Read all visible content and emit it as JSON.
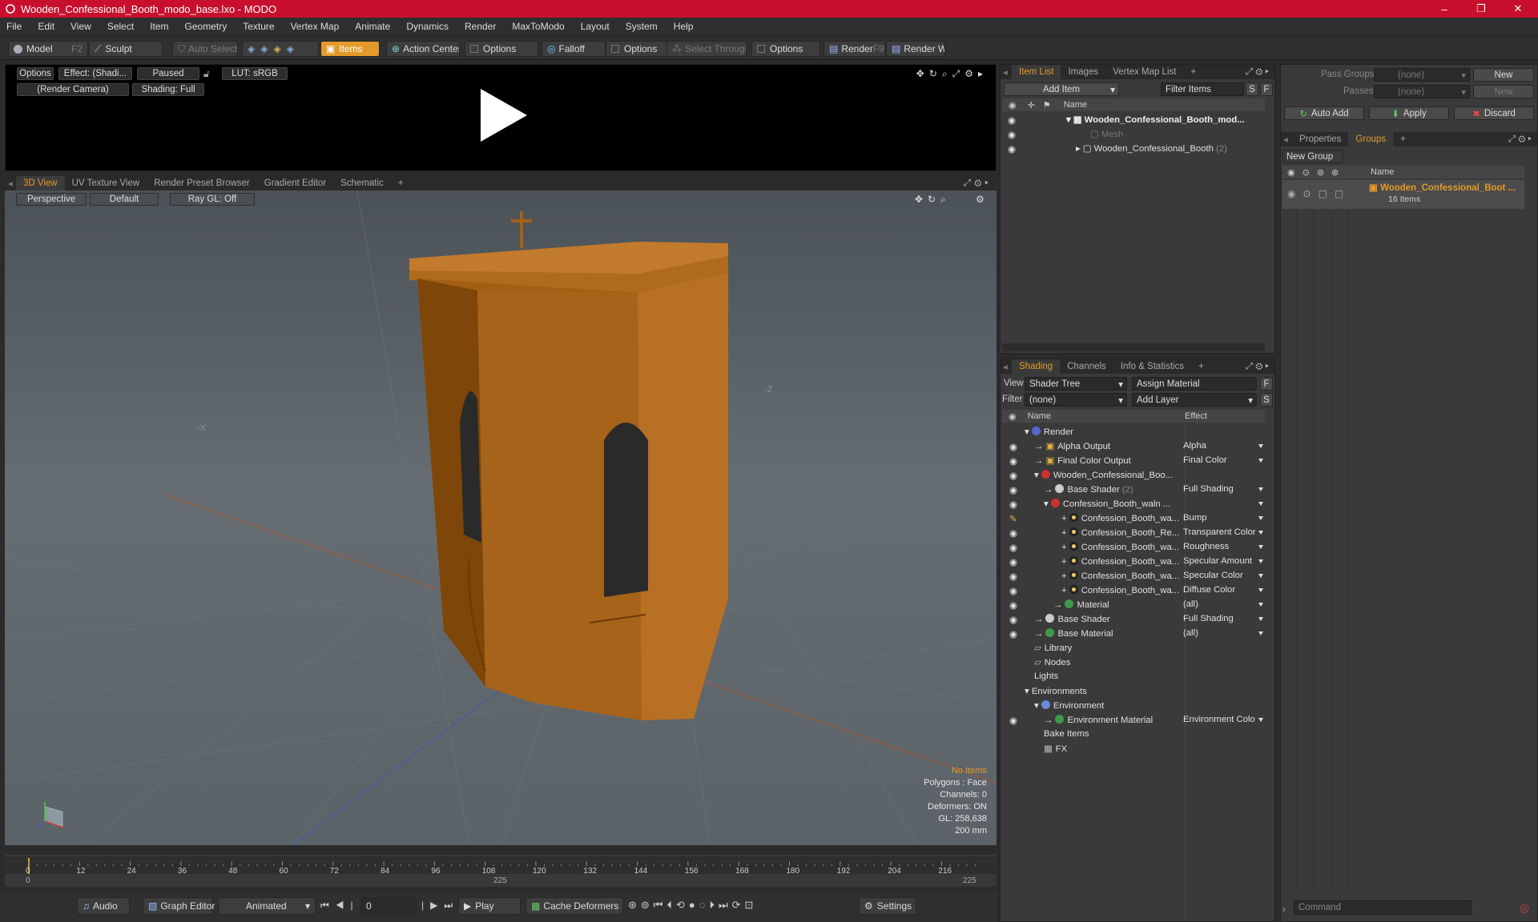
{
  "window": {
    "title": "Wooden_Confessional_Booth_modo_base.lxo - MODO",
    "minimize": "–",
    "maximize": "❐",
    "close": "✕"
  },
  "menu": [
    "File",
    "Edit",
    "View",
    "Select",
    "Item",
    "Geometry",
    "Texture",
    "Vertex Map",
    "Animate",
    "Dynamics",
    "Render",
    "MaxToModo",
    "Layout",
    "System",
    "Help"
  ],
  "toolbar": {
    "model": "Model",
    "model_key": "F2",
    "sculpt": "Sculpt",
    "auto_select": "Auto Select",
    "items": "Items",
    "action_center": "Action Center",
    "options1": "Options",
    "falloff": "Falloff",
    "options2": "Options",
    "select_through": "Select Through",
    "options3": "Options",
    "render": "Render",
    "render_key": "F9",
    "render_window": "Render Window"
  },
  "preview": {
    "options": "Options",
    "effect": "Effect: (Shadi...",
    "paused": "Paused",
    "lut": "LUT: sRGB",
    "camera": "(Render Camera)",
    "shading": "Shading: Full"
  },
  "view_tabs": [
    "3D View",
    "UV Texture View",
    "Render Preset Browser",
    "Gradient Editor",
    "Schematic",
    "+"
  ],
  "viewport": {
    "perspective": "Perspective",
    "default": "Default",
    "raygl": "Ray GL: Off",
    "axis_x": "-X",
    "axis_z": "-Z",
    "info": [
      "No Items",
      "Polygons : Face",
      "Channels: 0",
      "Deformers: ON",
      "GL: 258,638",
      "200 mm"
    ]
  },
  "timeline": {
    "ticks": [
      "0",
      "12",
      "24",
      "36",
      "48",
      "60",
      "72",
      "84",
      "96",
      "108",
      "120",
      "132",
      "144",
      "156",
      "168",
      "180",
      "192",
      "204",
      "216"
    ],
    "start": "0",
    "mid": "225",
    "end": "225"
  },
  "bottombar": {
    "audio": "Audio",
    "graph_editor": "Graph Editor",
    "animated": "Animated",
    "frame": "0",
    "play": "Play",
    "cache": "Cache Deformers",
    "settings": "Settings"
  },
  "item_list": {
    "tabs": [
      "Item List",
      "Images",
      "Vertex Map List",
      "+"
    ],
    "add_item": "Add Item",
    "filter": "Filter Items",
    "s": "S",
    "f": "F",
    "col_name": "Name",
    "rows": [
      {
        "name": "Wooden_Confessional_Booth_mod...",
        "count": ""
      },
      {
        "name": "Mesh",
        "count": ""
      },
      {
        "name": "Wooden_Confessional_Booth",
        "count": "(2)"
      }
    ]
  },
  "shading": {
    "tabs": [
      "Shading",
      "Channels",
      "Info & Statistics",
      "+"
    ],
    "view_label": "View",
    "view_value": "Shader Tree",
    "assign": "Assign Material",
    "f": "F",
    "filter_label": "Filter",
    "filter_value": "(none)",
    "add_layer": "Add Layer",
    "s": "S",
    "col_name": "Name",
    "col_effect": "Effect",
    "rows": [
      {
        "name": "Render",
        "effect": ""
      },
      {
        "name": "Alpha Output",
        "effect": "Alpha"
      },
      {
        "name": "Final Color Output",
        "effect": "Final Color"
      },
      {
        "name": "Wooden_Confessional_Boo...",
        "effect": ""
      },
      {
        "name": "Base Shader",
        "count": "(2)",
        "effect": "Full Shading"
      },
      {
        "name": "Confession_Booth_waln ...",
        "effect": ""
      },
      {
        "name": "Confession_Booth_wa...",
        "effect": "Bump"
      },
      {
        "name": "Confession_Booth_Re...",
        "effect": "Transparent Color"
      },
      {
        "name": "Confession_Booth_wa...",
        "effect": "Roughness"
      },
      {
        "name": "Confession_Booth_wa...",
        "effect": "Specular Amount"
      },
      {
        "name": "Confession_Booth_wa...",
        "effect": "Specular Color"
      },
      {
        "name": "Confession_Booth_wa...",
        "effect": "Diffuse Color"
      },
      {
        "name": "Material",
        "effect": "(all)"
      },
      {
        "name": "Base Shader",
        "effect": "Full Shading"
      },
      {
        "name": "Base Material",
        "effect": "(all)"
      },
      {
        "name": "Library",
        "effect": ""
      },
      {
        "name": "Nodes",
        "effect": ""
      },
      {
        "name": "Lights",
        "effect": ""
      },
      {
        "name": "Environments",
        "effect": ""
      },
      {
        "name": "Environment",
        "effect": ""
      },
      {
        "name": "Environment Material",
        "effect": "Environment Color"
      },
      {
        "name": "Bake Items",
        "effect": ""
      },
      {
        "name": "FX",
        "effect": ""
      }
    ]
  },
  "groups_panel": {
    "pass_groups": "Pass Groups",
    "pass_groups_value": "(none)",
    "new": "New",
    "passes": "Passes",
    "passes_value": "(none)",
    "new2": "New",
    "auto_add": "Auto Add",
    "apply": "Apply",
    "discard": "Discard",
    "tabs": [
      "Properties",
      "Groups",
      "+"
    ],
    "new_group": "New Group",
    "col_name": "Name",
    "group_name": "Wooden_Confessional_Boot ...",
    "group_count": "16 Items"
  },
  "command": {
    "placeholder": "Command"
  },
  "colors": {
    "title": "#c8102e",
    "accent": "#e49a2a",
    "wood": "#9a5a12"
  }
}
